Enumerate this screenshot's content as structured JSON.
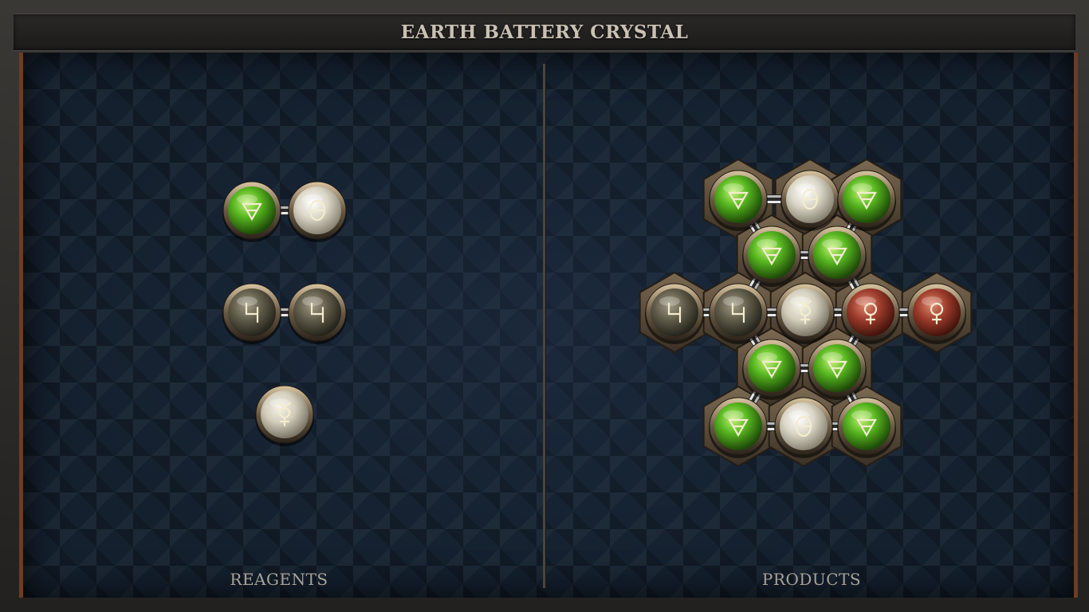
{
  "title": "EARTH BATTERY CRYSTAL",
  "panels": {
    "reagents_label": "REAGENTS",
    "products_label": "PRODUCTS"
  },
  "colors": {
    "earth": "#58b820",
    "salt": "#d9d5c5",
    "lead": "#5e5a48",
    "quicksilver": "#d2cdbb",
    "copper": "#9a3a2a",
    "frame_accent": "#6b3d22"
  },
  "glyphs": {
    "earth": "earth-icon",
    "salt": "salt-icon",
    "lead": "lead-icon",
    "quicksilver": "quicksilver-icon",
    "copper": "copper-icon"
  },
  "reagents": [
    {
      "atoms": [
        "earth",
        "salt"
      ]
    },
    {
      "atoms": [
        "lead",
        "lead"
      ]
    },
    {
      "atoms": [
        "quicksilver"
      ]
    }
  ],
  "product": {
    "atoms": [
      "earth",
      "salt",
      "earth",
      "earth",
      "earth",
      "lead",
      "lead",
      "quicksilver",
      "copper",
      "copper",
      "earth",
      "earth",
      "earth",
      "salt",
      "earth"
    ]
  }
}
